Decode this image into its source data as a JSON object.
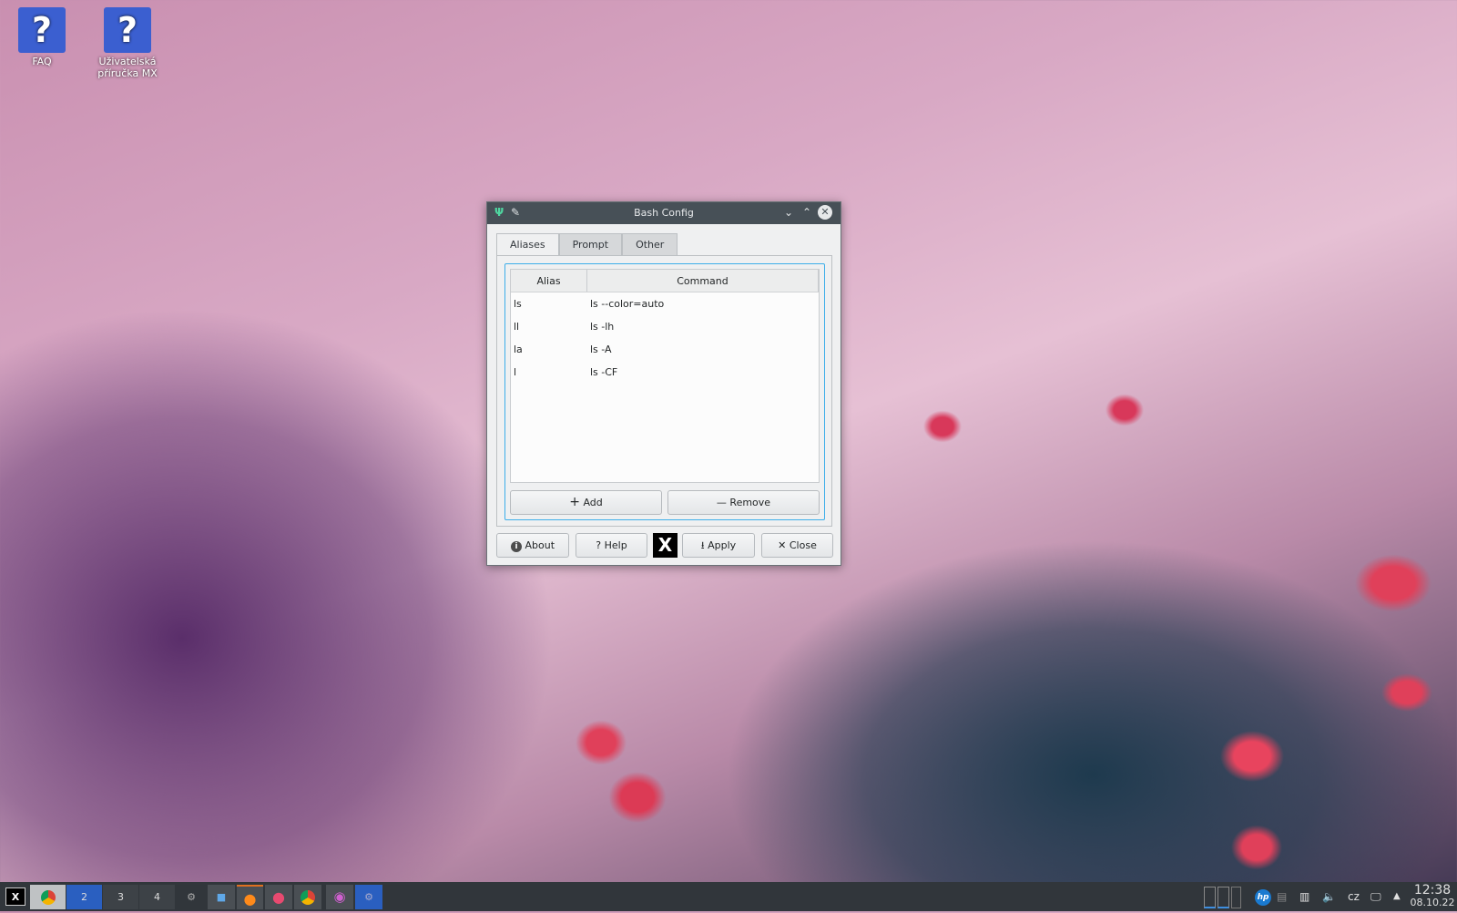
{
  "desktop": {
    "icons": [
      {
        "label": "FAQ",
        "icon": "help-question-icon"
      },
      {
        "label": "Uživatelská příručka MX",
        "icon": "help-question-icon"
      }
    ]
  },
  "dialog": {
    "title": "Bash Config",
    "tabs": [
      {
        "label": "Aliases",
        "active": true
      },
      {
        "label": "Prompt"
      },
      {
        "label": "Other"
      }
    ],
    "table": {
      "columns": [
        "Alias",
        "Command"
      ],
      "rows": [
        [
          "ls",
          "ls --color=auto"
        ],
        [
          "ll",
          "ls -lh"
        ],
        [
          "la",
          "ls -A"
        ],
        [
          "l",
          "ls -CF"
        ]
      ]
    },
    "add_label": "Add",
    "remove_label": "Remove",
    "about_label": "About",
    "help_label": "Help",
    "apply_label": "Apply",
    "close_label": "Close"
  },
  "taskbar": {
    "workspaces": [
      "2",
      "3",
      "4"
    ],
    "active_workspace": "2",
    "keyboard_layout": "cz",
    "time": "12:38",
    "date": "08.10.22"
  },
  "colors": {
    "accent": "#3daee9",
    "titlebar": "#475057",
    "taskbar": "#31363b",
    "workspace_active": "#2a5fc0"
  }
}
